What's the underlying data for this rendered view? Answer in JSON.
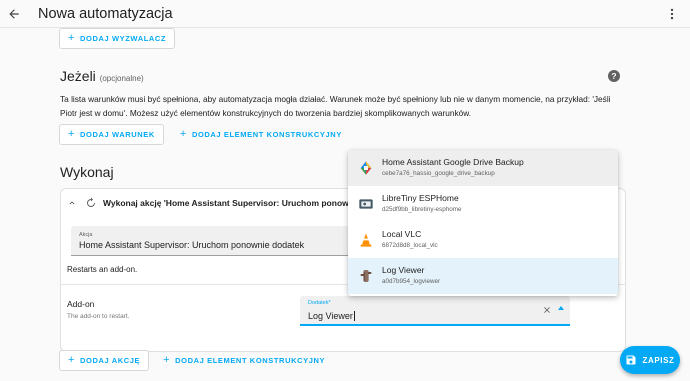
{
  "header": {
    "title": "Nowa automatyzacja"
  },
  "triggers": {
    "add_label": "DODAJ WYZWALACZ"
  },
  "conditions": {
    "title": "Jeżeli",
    "optional": "(opcjonalne)",
    "description": "Ta lista warunków musi być spełniona, aby automatyzacja mogła działać. Warunek może być spełniony lub nie w danym momencie, na przykład: 'Jeśli Piotr jest w domu'. Możesz użyć elementów konstrukcyjnych do tworzenia bardziej skomplikowanych warunków.",
    "add_label": "DODAJ WARUNEK",
    "add_block_label": "DODAJ ELEMENT KONSTRUKCYJNY"
  },
  "actions": {
    "title": "Wykonaj",
    "card_title": "Wykonaj akcję 'Home Assistant Supervisor: Uruchom ponownie dodatek'",
    "action_label": "Akcja",
    "action_value": "Home Assistant Supervisor: Uruchom ponownie dodatek",
    "description": "Restarts an add-on.",
    "addon_label": "Add-on",
    "addon_desc": "The add-on to restart.",
    "addon_field_label": "Dodatek*",
    "addon_field_value": "Log Viewer",
    "add_label": "DODAJ AKCJĘ",
    "add_block_label": "DODAJ ELEMENT KONSTRUKCYJNY"
  },
  "dropdown": {
    "options": [
      {
        "name": "Home Assistant Google Drive Backup",
        "slug": "cebe7a76_hassio_google_drive_backup",
        "icon": "google-drive-icon"
      },
      {
        "name": "LibreTiny ESPHome",
        "slug": "d25df9bb_libretiny-esphome",
        "icon": "esphome-board-icon"
      },
      {
        "name": "Local VLC",
        "slug": "6872d8d8_local_vlc",
        "icon": "vlc-cone-icon"
      },
      {
        "name": "Log Viewer",
        "slug": "a0d7b954_logviewer",
        "icon": "log-viewer-icon"
      }
    ]
  },
  "fab": {
    "label": "ZAPISZ"
  },
  "colors": {
    "accent": "#03a9f4",
    "highlight": "#eeeeee",
    "selected": "#e3f2fb"
  }
}
